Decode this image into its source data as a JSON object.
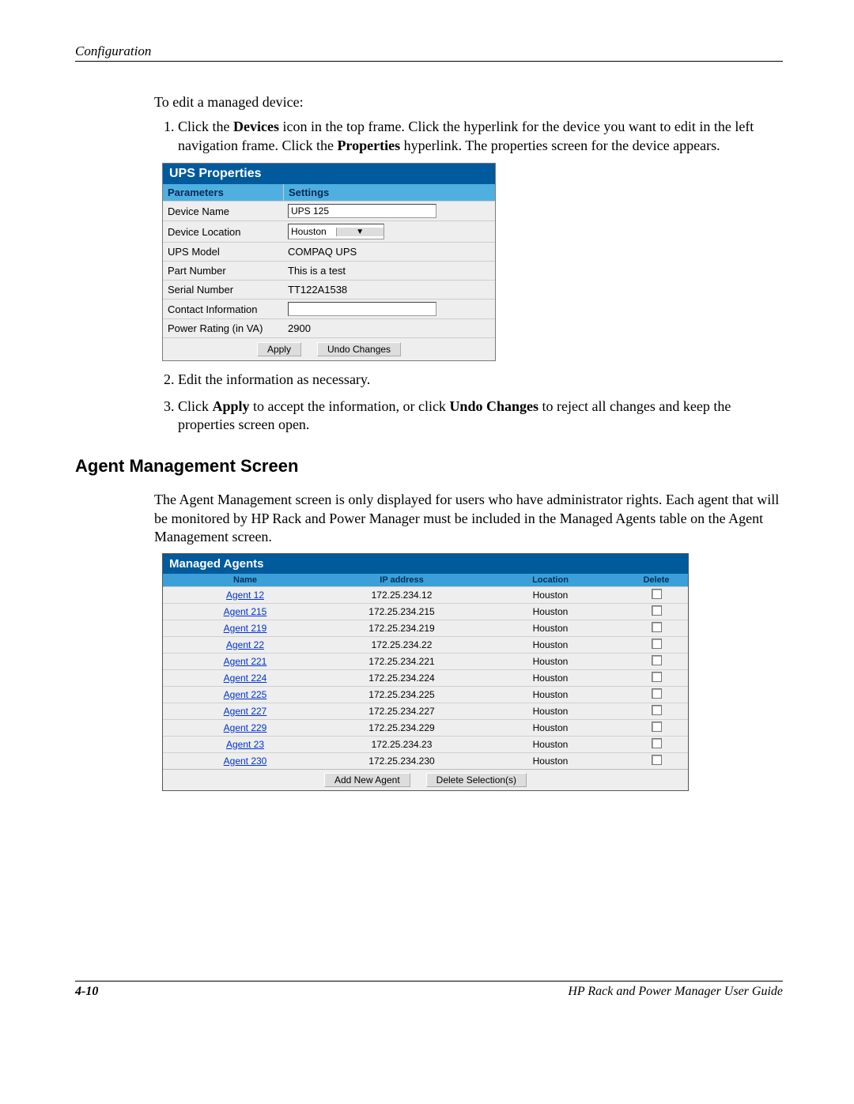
{
  "header": {
    "section": "Configuration"
  },
  "intro": {
    "line": "To edit a managed device:"
  },
  "steps1": {
    "s1_pre": "Click the ",
    "s1_b1": "Devices",
    "s1_mid1": " icon in the top frame. Click the hyperlink for the device you want to edit in the left navigation frame. Click the ",
    "s1_b2": "Properties",
    "s1_post": " hyperlink. The properties screen for the device appears."
  },
  "ups": {
    "title": "UPS Properties",
    "head_params": "Parameters",
    "head_settings": "Settings",
    "rows": {
      "device_name_label": "Device Name",
      "device_name_value": "UPS 125",
      "device_location_label": "Device Location",
      "device_location_value": "Houston",
      "ups_model_label": "UPS Model",
      "ups_model_value": "COMPAQ UPS",
      "part_number_label": "Part Number",
      "part_number_value": "This is a test",
      "serial_label": "Serial Number",
      "serial_value": "TT122A1538",
      "contact_label": "Contact Information",
      "contact_value": "",
      "power_label": "Power Rating (in VA)",
      "power_value": "2900"
    },
    "apply_btn": "Apply",
    "undo_btn": "Undo Changes"
  },
  "steps2": {
    "s2": "Edit the information as necessary.",
    "s3_pre": "Click ",
    "s3_b1": "Apply",
    "s3_mid": " to accept the information, or click ",
    "s3_b2": "Undo Changes",
    "s3_post": " to reject all changes and keep the properties screen open."
  },
  "section2": {
    "heading": "Agent Management Screen",
    "para": "The Agent Management screen is only displayed for users who have administrator rights. Each agent that will be monitored by HP Rack and Power Manager must be included in the Managed Agents table on the Agent Management screen."
  },
  "agents": {
    "title": "Managed Agents",
    "head_name": "Name",
    "head_ip": "IP address",
    "head_location": "Location",
    "head_delete": "Delete",
    "rows": [
      {
        "name": "Agent 12",
        "ip": "172.25.234.12",
        "location": "Houston"
      },
      {
        "name": "Agent 215",
        "ip": "172.25.234.215",
        "location": "Houston"
      },
      {
        "name": "Agent 219",
        "ip": "172.25.234.219",
        "location": "Houston"
      },
      {
        "name": "Agent 22",
        "ip": "172.25.234.22",
        "location": "Houston"
      },
      {
        "name": "Agent 221",
        "ip": "172.25.234.221",
        "location": "Houston"
      },
      {
        "name": "Agent 224",
        "ip": "172.25.234.224",
        "location": "Houston"
      },
      {
        "name": "Agent 225",
        "ip": "172.25.234.225",
        "location": "Houston"
      },
      {
        "name": "Agent 227",
        "ip": "172.25.234.227",
        "location": "Houston"
      },
      {
        "name": "Agent 229",
        "ip": "172.25.234.229",
        "location": "Houston"
      },
      {
        "name": "Agent 23",
        "ip": "172.25.234.23",
        "location": "Houston"
      },
      {
        "name": "Agent 230",
        "ip": "172.25.234.230",
        "location": "Houston"
      }
    ],
    "add_btn": "Add New Agent",
    "delete_btn": "Delete Selection(s)"
  },
  "footer": {
    "page_num": "4-10",
    "guide": "HP Rack and Power Manager User Guide"
  }
}
